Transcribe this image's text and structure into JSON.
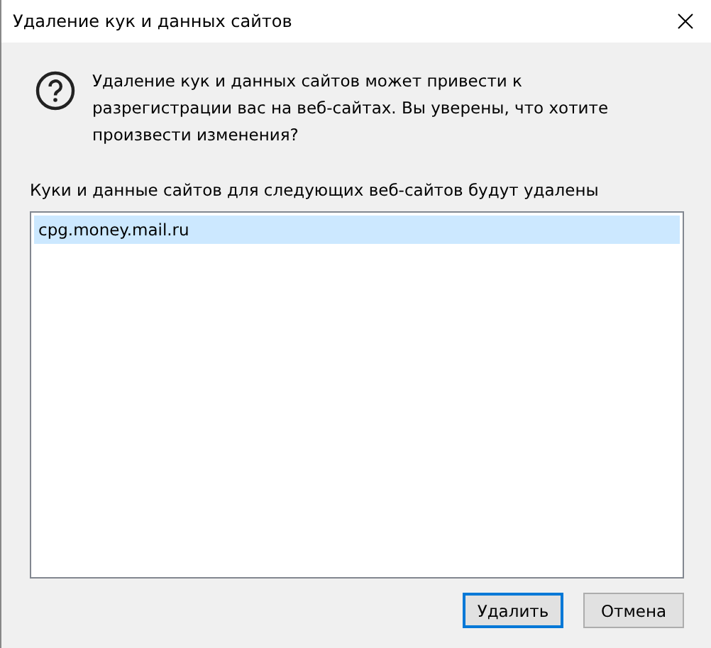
{
  "window": {
    "title": "Удаление кук и данных сайтов"
  },
  "message": "Удаление кук и данных сайтов может привести к разрегистрации вас на веб-сайтах. Вы уверены, что хотите произвести изменения?",
  "list_label": "Куки и данные сайтов для следующих веб-сайтов будут удалены",
  "sites": [
    {
      "label": "cpg.money.mail.ru",
      "selected": true
    }
  ],
  "buttons": [
    {
      "label": "Удалить",
      "default": true
    },
    {
      "label": "Отмена",
      "default": false
    }
  ]
}
